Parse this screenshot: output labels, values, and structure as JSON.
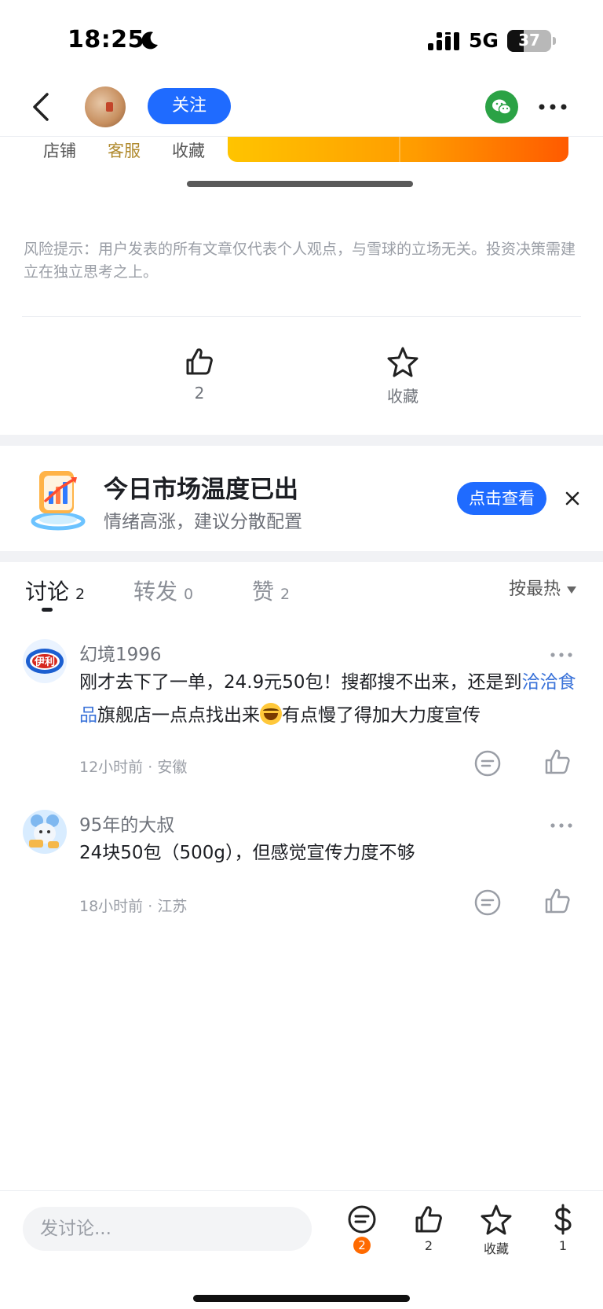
{
  "status": {
    "time": "18:25",
    "network": "5G",
    "battery": "37"
  },
  "nav": {
    "follow_label": "关注"
  },
  "shop": {
    "links": [
      "店铺",
      "客服",
      "收藏"
    ]
  },
  "risk_note": "风险提示：用户发表的所有文章仅代表个人观点，与雪球的立场无关。投资决策需建立在独立思考之上。",
  "post_actions": {
    "like_count": "2",
    "favorite_label": "收藏"
  },
  "promo": {
    "title": "今日市场温度已出",
    "subtitle": "情绪高涨，建议分散配置",
    "button": "点击查看"
  },
  "tabs": [
    {
      "label": "讨论",
      "count": "2"
    },
    {
      "label": "转发",
      "count": "0"
    },
    {
      "label": "赞",
      "count": "2"
    }
  ],
  "sort_label": "按最热",
  "comments": [
    {
      "user": "幻境1996",
      "text_before": "刚才去下了一单，24.9元50包！搜都搜不出来，还是到",
      "link": "洽洽食品",
      "text_after1": "旗舰店一点点找出来",
      "text_after2": "有点慢了得加大力度宣传",
      "time": "12小时前",
      "location": "安徽",
      "avatar_text": "伊利"
    },
    {
      "user": "95年的大叔",
      "text": "24块50包（500g），但感觉宣传力度不够",
      "time": "18小时前",
      "location": "江苏"
    }
  ],
  "bottom": {
    "input_placeholder": "发讨论...",
    "comment_badge": "2",
    "like_count": "2",
    "favorite_label": "收藏",
    "reward_count": "1"
  },
  "colors": {
    "accent": "#1f6bff",
    "link": "#3b73d9",
    "badge": "#ff6a00",
    "customer_service": "#b08a2e"
  }
}
